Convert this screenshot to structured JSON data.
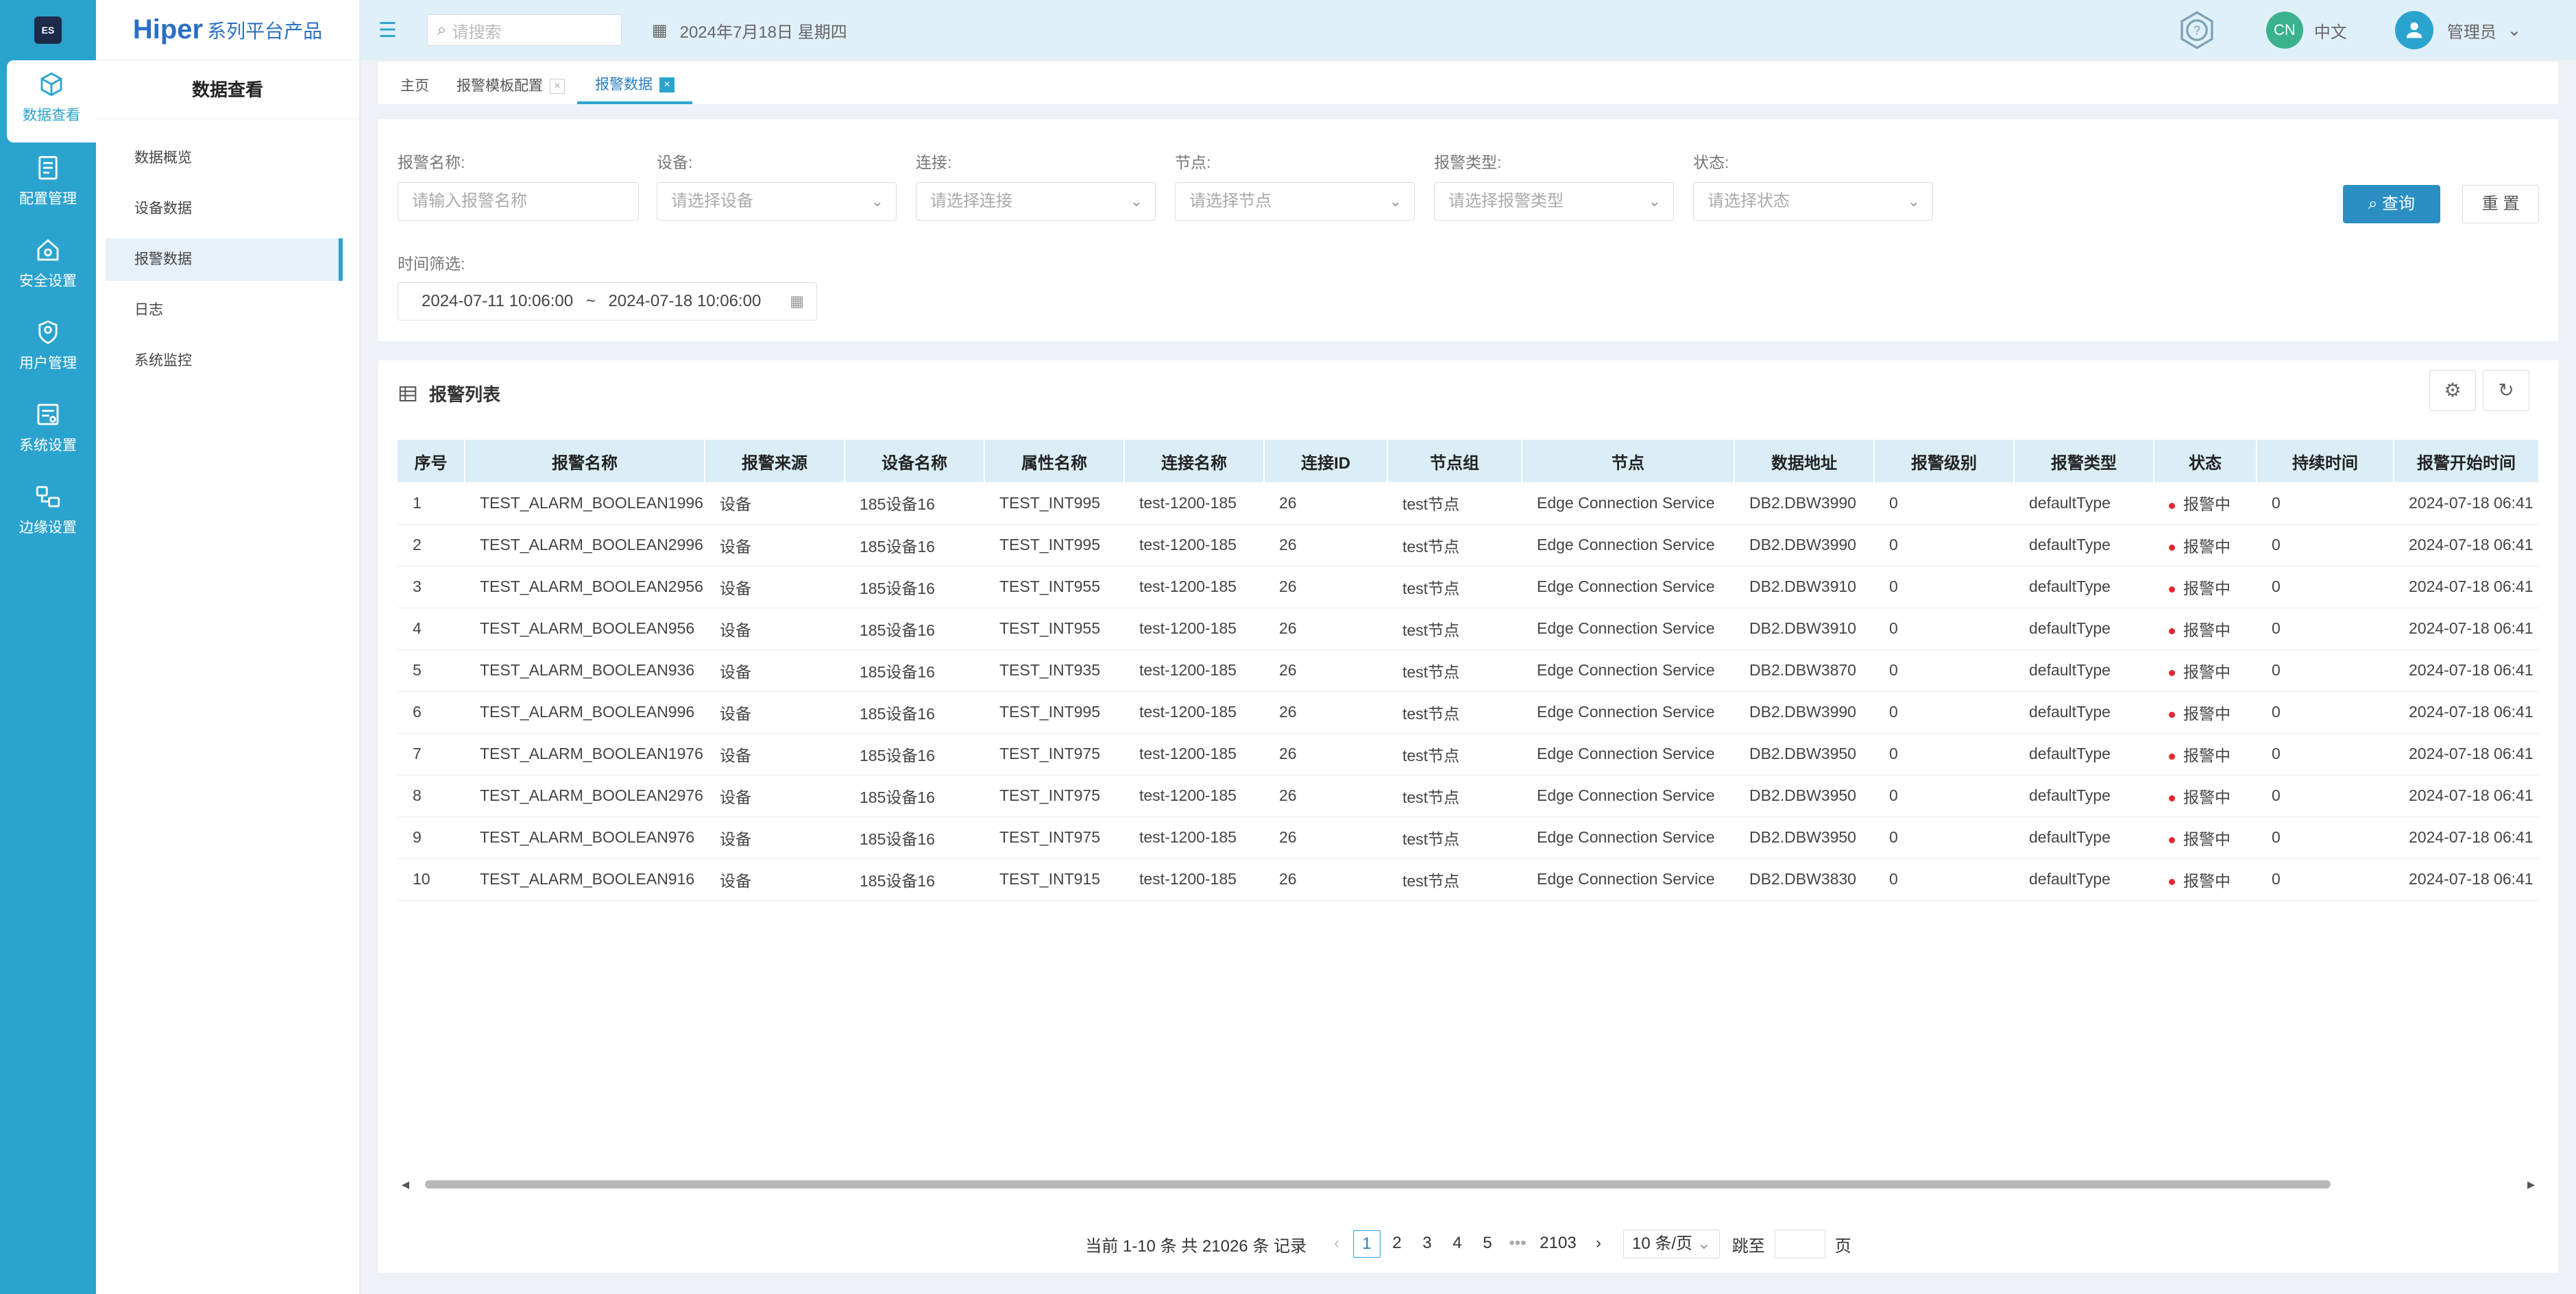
{
  "rail": {
    "logo": "ES",
    "items": [
      {
        "label": "数据查看",
        "icon": "cube-icon"
      },
      {
        "label": "配置管理",
        "icon": "document-icon"
      },
      {
        "label": "安全设置",
        "icon": "shield-home-icon"
      },
      {
        "label": "用户管理",
        "icon": "user-shield-icon"
      },
      {
        "label": "系统设置",
        "icon": "settings-panel-icon"
      },
      {
        "label": "边缘设置",
        "icon": "edge-icon"
      }
    ]
  },
  "sidebar": {
    "brand": "Hiper",
    "brand_sub": "系列平台产品",
    "group_title": "数据查看",
    "items": [
      "数据概览",
      "设备数据",
      "报警数据",
      "日志",
      "系统监控"
    ]
  },
  "header": {
    "search_placeholder": "请搜索",
    "date": "2024年7月18日 星期四",
    "lang_badge": "CN",
    "lang": "中文",
    "user": "管理员"
  },
  "tabs": [
    "主页",
    "报警模板配置",
    "报警数据"
  ],
  "filters": {
    "alarm_name_label": "报警名称:",
    "alarm_name_placeholder": "请输入报警名称",
    "device_label": "设备:",
    "device_placeholder": "请选择设备",
    "connection_label": "连接:",
    "connection_placeholder": "请选择连接",
    "node_label": "节点:",
    "node_placeholder": "请选择节点",
    "type_label": "报警类型:",
    "type_placeholder": "请选择报警类型",
    "status_label": "状态:",
    "status_placeholder": "请选择状态",
    "time_label": "时间筛选:",
    "time_start": "2024-07-11 10:06:00",
    "time_sep": "~",
    "time_end": "2024-07-18 10:06:00",
    "query": "查询",
    "reset": "重 置"
  },
  "list": {
    "title": "报警列表",
    "columns": [
      "序号",
      "报警名称",
      "报警来源",
      "设备名称",
      "属性名称",
      "连接名称",
      "连接ID",
      "节点组",
      "节点",
      "数据地址",
      "报警级别",
      "报警类型",
      "状态",
      "持续时间",
      "报警开始时间"
    ],
    "rows": [
      [
        "1",
        "TEST_ALARM_BOOLEAN1996",
        "设备",
        "185设备16",
        "TEST_INT995",
        "test-1200-185",
        "26",
        "test节点",
        "Edge Connection Service",
        "DB2.DBW3990",
        "0",
        "defaultType",
        "报警中",
        "0",
        "2024-07-18 06:41"
      ],
      [
        "2",
        "TEST_ALARM_BOOLEAN2996",
        "设备",
        "185设备16",
        "TEST_INT995",
        "test-1200-185",
        "26",
        "test节点",
        "Edge Connection Service",
        "DB2.DBW3990",
        "0",
        "defaultType",
        "报警中",
        "0",
        "2024-07-18 06:41"
      ],
      [
        "3",
        "TEST_ALARM_BOOLEAN2956",
        "设备",
        "185设备16",
        "TEST_INT955",
        "test-1200-185",
        "26",
        "test节点",
        "Edge Connection Service",
        "DB2.DBW3910",
        "0",
        "defaultType",
        "报警中",
        "0",
        "2024-07-18 06:41"
      ],
      [
        "4",
        "TEST_ALARM_BOOLEAN956",
        "设备",
        "185设备16",
        "TEST_INT955",
        "test-1200-185",
        "26",
        "test节点",
        "Edge Connection Service",
        "DB2.DBW3910",
        "0",
        "defaultType",
        "报警中",
        "0",
        "2024-07-18 06:41"
      ],
      [
        "5",
        "TEST_ALARM_BOOLEAN936",
        "设备",
        "185设备16",
        "TEST_INT935",
        "test-1200-185",
        "26",
        "test节点",
        "Edge Connection Service",
        "DB2.DBW3870",
        "0",
        "defaultType",
        "报警中",
        "0",
        "2024-07-18 06:41"
      ],
      [
        "6",
        "TEST_ALARM_BOOLEAN996",
        "设备",
        "185设备16",
        "TEST_INT995",
        "test-1200-185",
        "26",
        "test节点",
        "Edge Connection Service",
        "DB2.DBW3990",
        "0",
        "defaultType",
        "报警中",
        "0",
        "2024-07-18 06:41"
      ],
      [
        "7",
        "TEST_ALARM_BOOLEAN1976",
        "设备",
        "185设备16",
        "TEST_INT975",
        "test-1200-185",
        "26",
        "test节点",
        "Edge Connection Service",
        "DB2.DBW3950",
        "0",
        "defaultType",
        "报警中",
        "0",
        "2024-07-18 06:41"
      ],
      [
        "8",
        "TEST_ALARM_BOOLEAN2976",
        "设备",
        "185设备16",
        "TEST_INT975",
        "test-1200-185",
        "26",
        "test节点",
        "Edge Connection Service",
        "DB2.DBW3950",
        "0",
        "defaultType",
        "报警中",
        "0",
        "2024-07-18 06:41"
      ],
      [
        "9",
        "TEST_ALARM_BOOLEAN976",
        "设备",
        "185设备16",
        "TEST_INT975",
        "test-1200-185",
        "26",
        "test节点",
        "Edge Connection Service",
        "DB2.DBW3950",
        "0",
        "defaultType",
        "报警中",
        "0",
        "2024-07-18 06:41"
      ],
      [
        "10",
        "TEST_ALARM_BOOLEAN916",
        "设备",
        "185设备16",
        "TEST_INT915",
        "test-1200-185",
        "26",
        "test节点",
        "Edge Connection Service",
        "DB2.DBW3830",
        "0",
        "defaultType",
        "报警中",
        "0",
        "2024-07-18 06:41"
      ]
    ]
  },
  "pager": {
    "summary": "当前 1-10 条 共 21026 条 记录",
    "pages": [
      "1",
      "2",
      "3",
      "4",
      "5"
    ],
    "ellipsis": "•••",
    "last": "2103",
    "page_size": "10 条/页",
    "jump_label": "跳至",
    "page_suffix": "页"
  },
  "colors": {
    "accent": "#2ba3cf",
    "header_bg": "#e0f0f9",
    "alarm_dot": "#e0282e"
  }
}
